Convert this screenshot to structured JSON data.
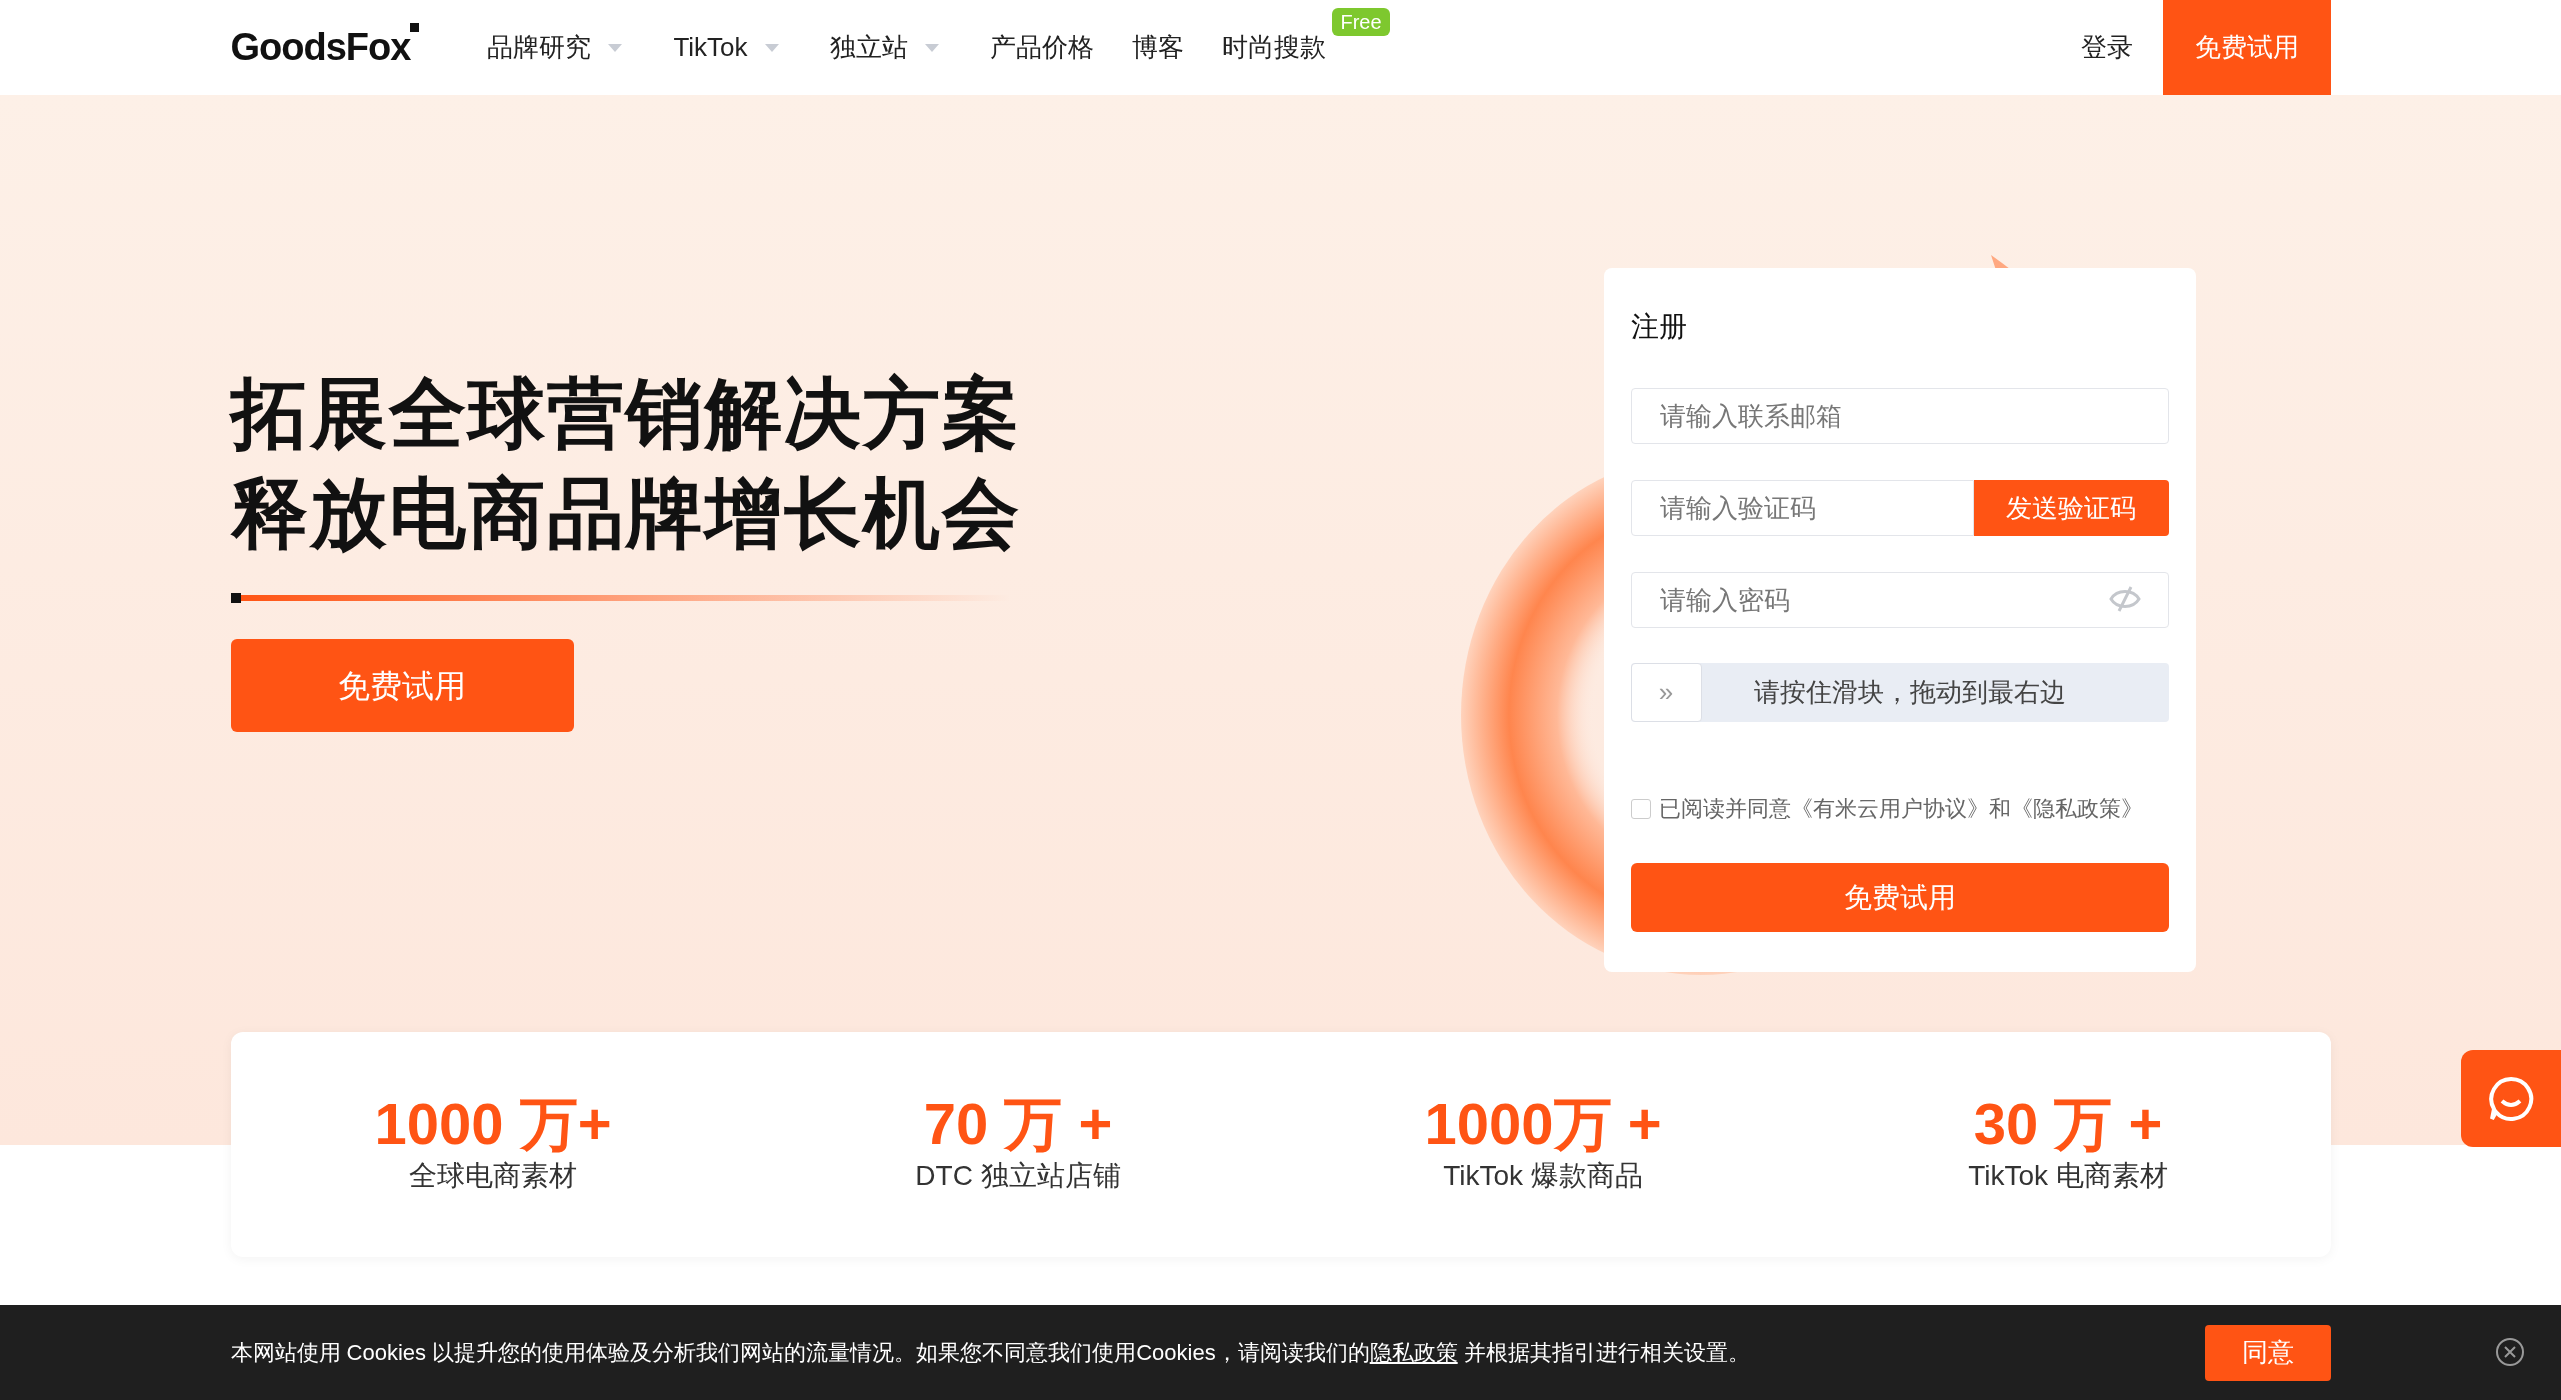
{
  "logo": {
    "text": "GoodsFox"
  },
  "nav": {
    "items": [
      {
        "label": "品牌研究",
        "dropdown": true
      },
      {
        "label": "TikTok",
        "dropdown": true
      },
      {
        "label": "独立站",
        "dropdown": true
      },
      {
        "label": "产品价格",
        "dropdown": false
      },
      {
        "label": "博客",
        "dropdown": false
      },
      {
        "label": "时尚搜款",
        "dropdown": false,
        "badge": "Free"
      }
    ],
    "login": "登录",
    "trial": "免费试用"
  },
  "hero": {
    "title_lines": [
      "拓展全球营销解决方案",
      "释放电商品牌增长机会"
    ],
    "button": "免费试用"
  },
  "register": {
    "title": "注册",
    "email": {
      "placeholder": "请输入联系邮箱"
    },
    "code": {
      "placeholder": "请输入验证码",
      "button": "发送验证码"
    },
    "password": {
      "placeholder": "请输入密码"
    },
    "slider": {
      "thumb": "»",
      "text": "请按住滑块，拖动到最右边",
      "level": 0
    },
    "agreement": {
      "checked": false,
      "text": "已阅读并同意《有米云用户协议》和《隐私政策》"
    },
    "submit": "免费试用"
  },
  "stats": [
    {
      "value": "1000 万+",
      "label": "全球电商素材"
    },
    {
      "value": "70 万 +",
      "label": "DTC 独立站店铺"
    },
    {
      "value": "1000万 +",
      "label": "TikTok 爆款商品"
    },
    {
      "value": "30 万 +",
      "label": "TikTok 电商素材"
    }
  ],
  "cookie_bar": {
    "text_before": "本网站使用 Cookies 以提升您的使用体验及分析我们网站的流量情况。如果您不同意我们使用Cookies，请阅读我们的",
    "link": "隐私政策",
    "text_after": " 并根据其指引进行相关设置。",
    "agree": "同意"
  }
}
